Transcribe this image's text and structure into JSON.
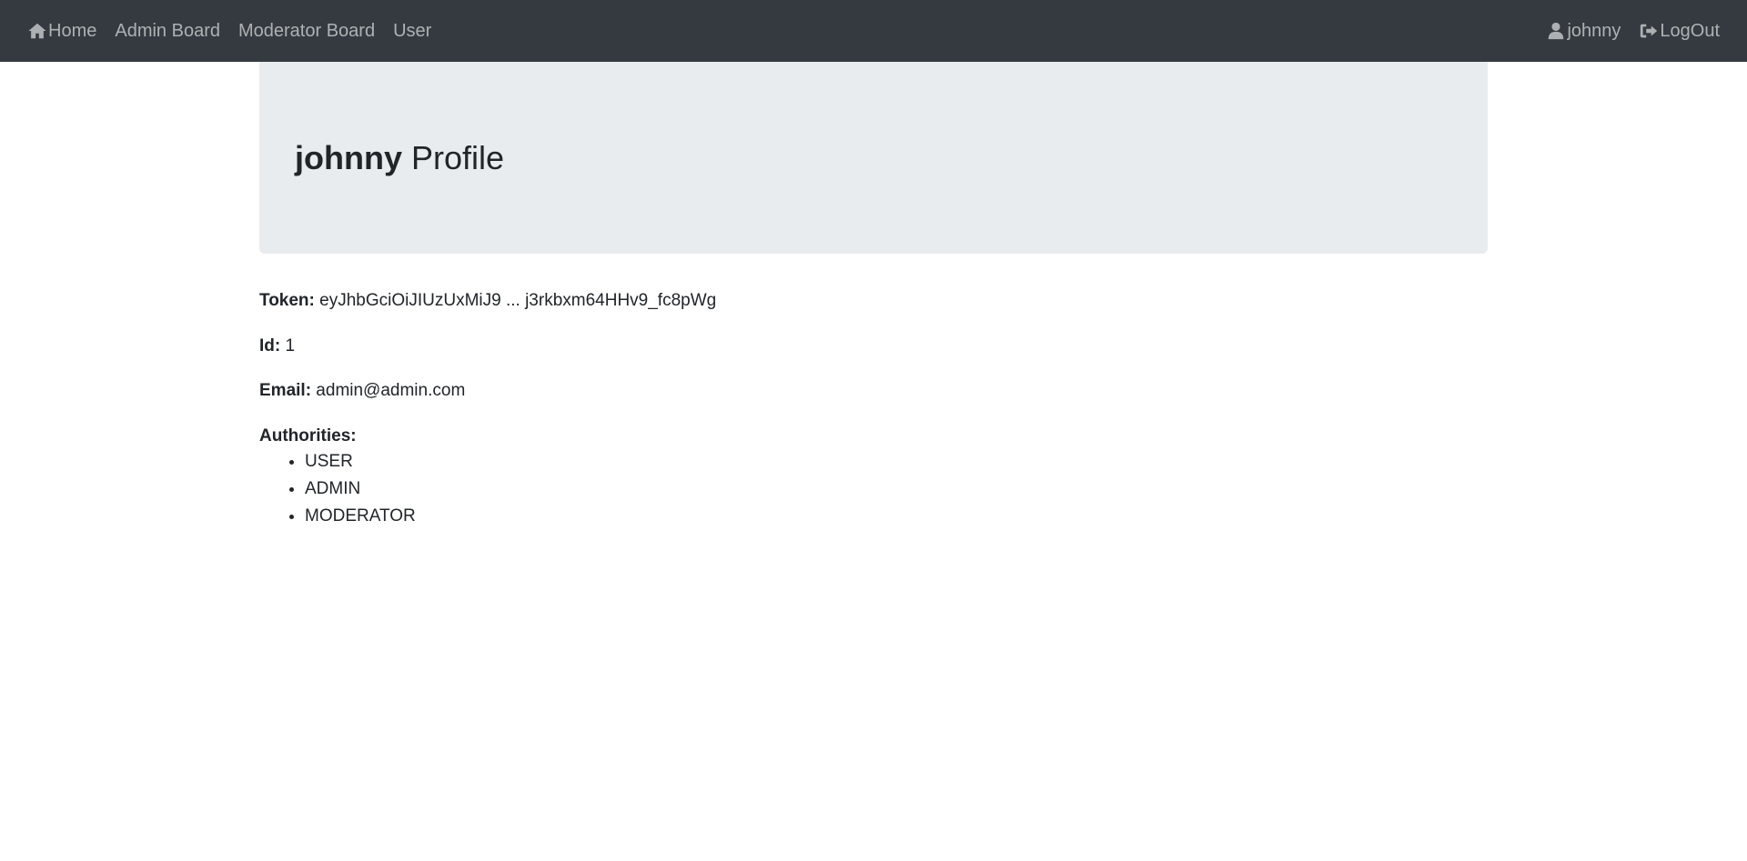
{
  "navbar": {
    "left_items": [
      {
        "label": "Home",
        "icon": "home-icon"
      },
      {
        "label": "Admin Board"
      },
      {
        "label": "Moderator Board"
      },
      {
        "label": "User"
      }
    ],
    "right_items": [
      {
        "label": "johnny",
        "icon": "user-icon"
      },
      {
        "label": "LogOut",
        "icon": "logout-icon"
      }
    ],
    "background_color": "#343a40"
  },
  "profile": {
    "username": "johnny",
    "title_suffix": " Profile",
    "token_label": "Token:",
    "token_value": " eyJhbGciOiJIUzUxMiJ9 ... j3rkbxm64HHv9_fc8pWg",
    "id_label": "Id:",
    "id_value": " 1",
    "email_label": "Email:",
    "email_value": " admin@admin.com",
    "authorities_label": "Authorities:",
    "authorities": [
      "USER",
      "ADMIN",
      "MODERATOR"
    ]
  }
}
